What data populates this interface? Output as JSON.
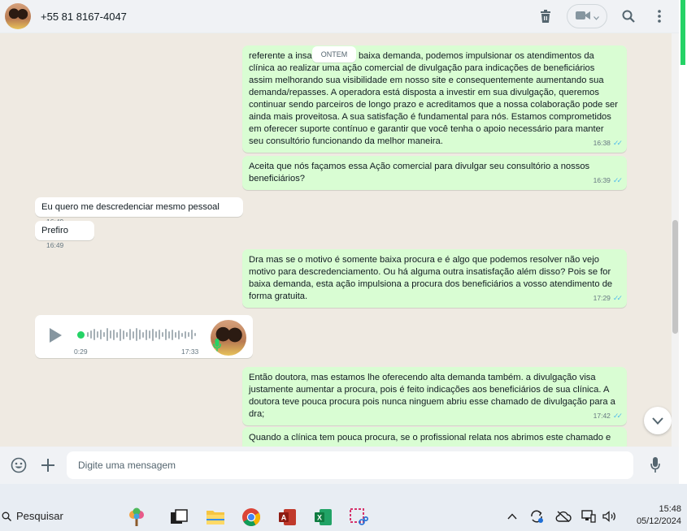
{
  "header": {
    "contact_name": "+55 81 8167-4047"
  },
  "icons": {
    "delete": "trash-icon",
    "video": "video-camera-icon",
    "search": "search-icon",
    "menu": "kebab-menu-icon"
  },
  "chat": {
    "date_separator": "ONTEM",
    "messages": [
      {
        "direction": "out",
        "text": "referente a insatisfação de baixa demanda, podemos impulsionar os atendimentos da clínica ao realizar uma ação comercial de divulgação para indicações de beneficiários assim melhorando sua visibilidade em nosso site e consequentemente aumentando sua demanda/repasses. A operadora está disposta a investir em sua divulgação, queremos continuar sendo parceiros de longo prazo e acreditamos que a nossa colaboração pode ser ainda mais proveitosa. A sua satisfação é fundamental para nós. Estamos comprometidos em oferecer suporte contínuo e garantir que você tenha o apoio necessário para manter seu consultório funcionando da melhor maneira.",
        "time": "16:38"
      },
      {
        "direction": "out",
        "text": "Aceita que nós façamos essa Ação comercial para divulgar seu consultório a nossos beneficiários?",
        "time": "16:39"
      },
      {
        "direction": "in",
        "text": "Eu quero me descredenciar mesmo pessoal",
        "time": "16:49"
      },
      {
        "direction": "in",
        "text": "Prefiro",
        "time": "16:49"
      },
      {
        "direction": "out",
        "text": "Dra mas se o motivo é somente baixa procura e é algo que podemos resolver não vejo motivo para descredenciamento. Ou há alguma outra insatisfação além disso? Pois se for baixa demanda, esta ação impulsiona a procura dos beneficiários a vosso atendimento de forma gratuita.",
        "time": "17:29"
      },
      {
        "direction": "out",
        "text": "Então doutora, mas estamos lhe oferecendo alta demanda também. a divulgação visa justamente aumentar a procura, pois é feito indicações aos beneficiários de sua clínica. A doutora teve pouca procura pois nunca ninguem abriu esse chamado de divulgação para a dra;",
        "time": "17:42"
      },
      {
        "direction": "out",
        "text": "Quando a clínica tem pouca procura, se o profissional relata nos abrimos este chamado e",
        "time": ""
      }
    ],
    "voice_message": {
      "duration": "0:29",
      "time": "17:33",
      "play_icon": "play-icon",
      "mic_icon": "microphone-icon"
    }
  },
  "composer": {
    "placeholder": "Digite uma mensagem",
    "emoji_icon": "emoji-icon",
    "attach_icon": "plus-icon",
    "mic_icon": "microphone-icon"
  },
  "taskbar": {
    "search_label": "Pesquisar",
    "apps": [
      "widgets-icon",
      "task-view-icon",
      "file-explorer-icon",
      "chrome-icon",
      "access-icon",
      "excel-icon",
      "snipping-tool-icon"
    ],
    "tray": [
      "chevron-up-icon",
      "sync-icon",
      "cloud-offline-icon",
      "display-icon",
      "speaker-icon"
    ],
    "time": "15:48",
    "date": "05/12/2024"
  }
}
